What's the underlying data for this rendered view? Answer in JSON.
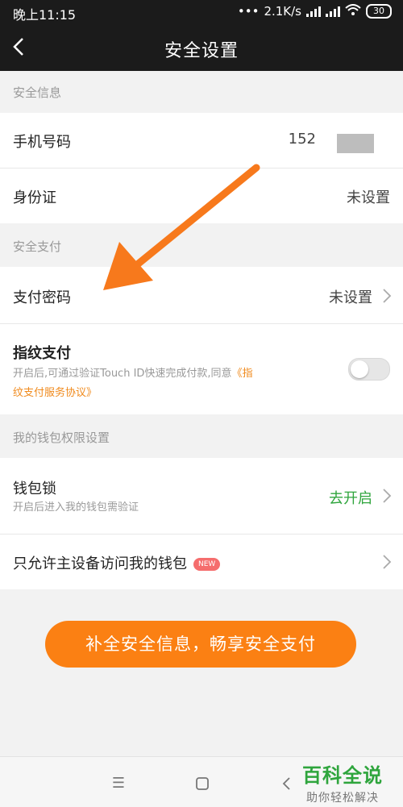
{
  "statusbar": {
    "time": "晚上11:15",
    "speed": "2.1K/s",
    "battery": "30"
  },
  "header": {
    "title": "安全设置"
  },
  "sections": {
    "info": {
      "title": "安全信息"
    },
    "pay": {
      "title": "安全支付"
    },
    "perm": {
      "title": "我的钱包权限设置"
    }
  },
  "rows": {
    "phone": {
      "label": "手机号码",
      "value": "152"
    },
    "id": {
      "label": "身份证",
      "value": "未设置"
    },
    "paypwd": {
      "label": "支付密码",
      "value": "未设置"
    },
    "fingerprint": {
      "label": "指纹支付",
      "desc_prefix": "开启后,可通过验证Touch ID快速完成付款,同意",
      "desc_link1": "《指",
      "desc_link2": "纹支付服务协议》",
      "toggle_on": false
    },
    "walletlock": {
      "label": "钱包锁",
      "desc": "开启后进入我的钱包需验证",
      "value": "去开启"
    },
    "mainonly": {
      "label": "只允许主设备访问我的钱包",
      "badge": "NEW"
    }
  },
  "cta": {
    "label": "补全安全信息，畅享安全支付"
  },
  "watermark": {
    "title": "百科全说",
    "subtitle": "助你轻松解决"
  },
  "colors": {
    "accent": "#fb8013",
    "link": "#f08a1c",
    "green": "#2fa53d",
    "topbar": "#1b1b1b"
  }
}
